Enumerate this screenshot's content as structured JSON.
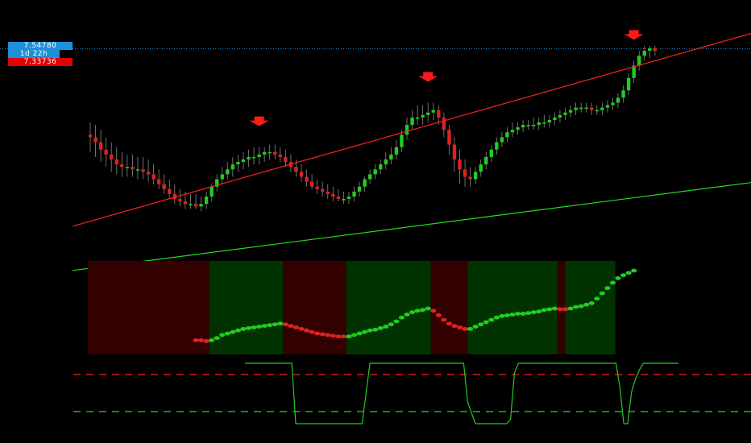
{
  "colors": {
    "background": "#000000",
    "bull": "#22cc22",
    "bear": "#dd2222",
    "wick": "#888888",
    "upper_channel": "#ff2020",
    "lower_channel": "#22dd22",
    "bull_zone": "#003300",
    "bear_zone": "#330000",
    "price_tag": "#1e90d8",
    "low_tag": "#e00000",
    "arrow": "#ff1a1a"
  },
  "price_labels": {
    "last": "7.54780",
    "countdown": "1d 22h",
    "low": "7.33736"
  },
  "chart_data": [
    {
      "type": "candlestick",
      "ohlc": [
        [
          7.2,
          7.25,
          7.13,
          7.19
        ],
        [
          7.19,
          7.24,
          7.11,
          7.17
        ],
        [
          7.17,
          7.22,
          7.09,
          7.14
        ],
        [
          7.14,
          7.19,
          7.07,
          7.12
        ],
        [
          7.12,
          7.17,
          7.05,
          7.1
        ],
        [
          7.1,
          7.15,
          7.04,
          7.08
        ],
        [
          7.08,
          7.13,
          7.03,
          7.07
        ],
        [
          7.07,
          7.12,
          7.03,
          7.07
        ],
        [
          7.07,
          7.12,
          7.03,
          7.06
        ],
        [
          7.06,
          7.11,
          7.02,
          7.06
        ],
        [
          7.06,
          7.11,
          7.02,
          7.05
        ],
        [
          7.05,
          7.1,
          7.01,
          7.04
        ],
        [
          7.04,
          7.08,
          7.0,
          7.02
        ],
        [
          7.02,
          7.06,
          6.98,
          7.0
        ],
        [
          7.0,
          7.04,
          6.96,
          6.98
        ],
        [
          6.98,
          7.02,
          6.94,
          6.96
        ],
        [
          6.96,
          7.0,
          6.92,
          6.94
        ],
        [
          6.94,
          6.98,
          6.91,
          6.93
        ],
        [
          6.93,
          6.97,
          6.9,
          6.92
        ],
        [
          6.92,
          6.96,
          6.9,
          6.92
        ],
        [
          6.92,
          6.96,
          6.9,
          6.91
        ],
        [
          6.91,
          6.95,
          6.89,
          6.92
        ],
        [
          6.92,
          6.97,
          6.9,
          6.95
        ],
        [
          6.95,
          7.0,
          6.93,
          6.99
        ],
        [
          6.99,
          7.04,
          6.97,
          7.02
        ],
        [
          7.02,
          7.07,
          7.0,
          7.04
        ],
        [
          7.04,
          7.09,
          7.02,
          7.06
        ],
        [
          7.06,
          7.11,
          7.03,
          7.08
        ],
        [
          7.08,
          7.12,
          7.05,
          7.09
        ],
        [
          7.09,
          7.13,
          7.06,
          7.1
        ],
        [
          7.1,
          7.14,
          7.07,
          7.11
        ],
        [
          7.11,
          7.15,
          7.08,
          7.11
        ],
        [
          7.11,
          7.15,
          7.08,
          7.12
        ],
        [
          7.12,
          7.15,
          7.09,
          7.13
        ],
        [
          7.13,
          7.16,
          7.1,
          7.13
        ],
        [
          7.13,
          7.16,
          7.1,
          7.12
        ],
        [
          7.12,
          7.15,
          7.09,
          7.11
        ],
        [
          7.11,
          7.14,
          7.07,
          7.09
        ],
        [
          7.09,
          7.12,
          7.05,
          7.07
        ],
        [
          7.07,
          7.1,
          7.03,
          7.05
        ],
        [
          7.05,
          7.08,
          7.01,
          7.03
        ],
        [
          7.03,
          7.06,
          6.99,
          7.01
        ],
        [
          7.01,
          7.04,
          6.98,
          6.99
        ],
        [
          6.99,
          7.02,
          6.96,
          6.98
        ],
        [
          6.98,
          7.01,
          6.95,
          6.97
        ],
        [
          6.97,
          7.0,
          6.94,
          6.96
        ],
        [
          6.96,
          6.99,
          6.93,
          6.95
        ],
        [
          6.95,
          6.98,
          6.93,
          6.94
        ],
        [
          6.94,
          6.97,
          6.92,
          6.94
        ],
        [
          6.94,
          6.97,
          6.92,
          6.95
        ],
        [
          6.95,
          6.99,
          6.93,
          6.97
        ],
        [
          6.97,
          7.01,
          6.95,
          6.99
        ],
        [
          6.99,
          7.03,
          6.97,
          7.02
        ],
        [
          7.02,
          7.06,
          7.0,
          7.04
        ],
        [
          7.04,
          7.08,
          7.02,
          7.06
        ],
        [
          7.06,
          7.1,
          7.04,
          7.08
        ],
        [
          7.08,
          7.13,
          7.06,
          7.1
        ],
        [
          7.1,
          7.15,
          7.08,
          7.12
        ],
        [
          7.12,
          7.18,
          7.1,
          7.15
        ],
        [
          7.15,
          7.22,
          7.13,
          7.2
        ],
        [
          7.2,
          7.27,
          7.18,
          7.24
        ],
        [
          7.24,
          7.3,
          7.22,
          7.27
        ],
        [
          7.27,
          7.32,
          7.24,
          7.27
        ],
        [
          7.27,
          7.32,
          7.24,
          7.28
        ],
        [
          7.28,
          7.33,
          7.25,
          7.29
        ],
        [
          7.29,
          7.33,
          7.26,
          7.3
        ],
        [
          7.3,
          7.32,
          7.24,
          7.27
        ],
        [
          7.27,
          7.29,
          7.19,
          7.22
        ],
        [
          7.22,
          7.24,
          7.12,
          7.16
        ],
        [
          7.16,
          7.19,
          7.05,
          7.1
        ],
        [
          7.1,
          7.14,
          7.0,
          7.06
        ],
        [
          7.06,
          7.1,
          6.99,
          7.03
        ],
        [
          7.03,
          7.07,
          6.99,
          7.02
        ],
        [
          7.02,
          7.07,
          7.0,
          7.05
        ],
        [
          7.05,
          7.1,
          7.03,
          7.08
        ],
        [
          7.08,
          7.13,
          7.06,
          7.11
        ],
        [
          7.11,
          7.16,
          7.09,
          7.14
        ],
        [
          7.14,
          7.19,
          7.12,
          7.17
        ],
        [
          7.17,
          7.21,
          7.15,
          7.19
        ],
        [
          7.19,
          7.23,
          7.17,
          7.21
        ],
        [
          7.21,
          7.25,
          7.19,
          7.22
        ],
        [
          7.22,
          7.25,
          7.2,
          7.23
        ],
        [
          7.23,
          7.26,
          7.21,
          7.24
        ],
        [
          7.24,
          7.26,
          7.22,
          7.24
        ],
        [
          7.24,
          7.27,
          7.22,
          7.24
        ],
        [
          7.24,
          7.27,
          7.22,
          7.25
        ],
        [
          7.25,
          7.28,
          7.23,
          7.25
        ],
        [
          7.25,
          7.28,
          7.23,
          7.26
        ],
        [
          7.26,
          7.29,
          7.24,
          7.27
        ],
        [
          7.27,
          7.3,
          7.25,
          7.28
        ],
        [
          7.28,
          7.31,
          7.26,
          7.29
        ],
        [
          7.29,
          7.32,
          7.27,
          7.3
        ],
        [
          7.3,
          7.33,
          7.28,
          7.31
        ],
        [
          7.31,
          7.33,
          7.29,
          7.31
        ],
        [
          7.31,
          7.33,
          7.29,
          7.31
        ],
        [
          7.31,
          7.33,
          7.28,
          7.3
        ],
        [
          7.3,
          7.32,
          7.28,
          7.3
        ],
        [
          7.3,
          7.33,
          7.28,
          7.31
        ],
        [
          7.31,
          7.34,
          7.29,
          7.32
        ],
        [
          7.32,
          7.35,
          7.3,
          7.33
        ],
        [
          7.33,
          7.37,
          7.31,
          7.35
        ],
        [
          7.35,
          7.4,
          7.33,
          7.38
        ],
        [
          7.38,
          7.45,
          7.36,
          7.43
        ],
        [
          7.43,
          7.5,
          7.41,
          7.48
        ],
        [
          7.48,
          7.54,
          7.46,
          7.52
        ],
        [
          7.52,
          7.56,
          7.5,
          7.54
        ],
        [
          7.54,
          7.56,
          7.51,
          7.55
        ],
        [
          7.55,
          7.56,
          7.52,
          7.54
        ]
      ],
      "channel_upper": [
        [
          0,
          6.85
        ],
        [
          112,
          7.53
        ]
      ],
      "channel_lower": [
        [
          0,
          6.66
        ],
        [
          112,
          6.97
        ]
      ],
      "sell_arrows_at": [
        32,
        64,
        103
      ],
      "price_levels": {
        "last": 7.5478,
        "low": 7.33736
      }
    },
    {
      "type": "scatter",
      "zones": [
        {
          "from": 0,
          "to": 23,
          "state": "bear"
        },
        {
          "from": 23,
          "to": 37,
          "state": "bull"
        },
        {
          "from": 37,
          "to": 49,
          "state": "bear"
        },
        {
          "from": 49,
          "to": 65,
          "state": "bull"
        },
        {
          "from": 65,
          "to": 72,
          "state": "bear"
        },
        {
          "from": 72,
          "to": 89,
          "state": "bull"
        },
        {
          "from": 89,
          "to": 90.5,
          "state": "bear"
        },
        {
          "from": 90.5,
          "to": 100,
          "state": "bull"
        }
      ],
      "dots": [
        {
          "i": 20,
          "v": 0.08,
          "s": "bear"
        },
        {
          "i": 21,
          "v": 0.08,
          "s": "bear"
        },
        {
          "i": 22,
          "v": 0.07,
          "s": "bear"
        },
        {
          "i": 23,
          "v": 0.08,
          "s": "bull"
        },
        {
          "i": 24,
          "v": 0.11,
          "s": "bull"
        },
        {
          "i": 25,
          "v": 0.15,
          "s": "bull"
        },
        {
          "i": 26,
          "v": 0.17,
          "s": "bull"
        },
        {
          "i": 27,
          "v": 0.19,
          "s": "bull"
        },
        {
          "i": 28,
          "v": 0.21,
          "s": "bull"
        },
        {
          "i": 29,
          "v": 0.23,
          "s": "bull"
        },
        {
          "i": 30,
          "v": 0.24,
          "s": "bull"
        },
        {
          "i": 31,
          "v": 0.25,
          "s": "bull"
        },
        {
          "i": 32,
          "v": 0.26,
          "s": "bull"
        },
        {
          "i": 33,
          "v": 0.27,
          "s": "bull"
        },
        {
          "i": 34,
          "v": 0.28,
          "s": "bull"
        },
        {
          "i": 35,
          "v": 0.29,
          "s": "bull"
        },
        {
          "i": 36,
          "v": 0.3,
          "s": "bull"
        },
        {
          "i": 37,
          "v": 0.29,
          "s": "bear"
        },
        {
          "i": 38,
          "v": 0.27,
          "s": "bear"
        },
        {
          "i": 39,
          "v": 0.25,
          "s": "bear"
        },
        {
          "i": 40,
          "v": 0.23,
          "s": "bear"
        },
        {
          "i": 41,
          "v": 0.21,
          "s": "bear"
        },
        {
          "i": 42,
          "v": 0.19,
          "s": "bear"
        },
        {
          "i": 43,
          "v": 0.17,
          "s": "bear"
        },
        {
          "i": 44,
          "v": 0.16,
          "s": "bear"
        },
        {
          "i": 45,
          "v": 0.15,
          "s": "bear"
        },
        {
          "i": 46,
          "v": 0.14,
          "s": "bear"
        },
        {
          "i": 47,
          "v": 0.13,
          "s": "bear"
        },
        {
          "i": 48,
          "v": 0.13,
          "s": "bear"
        },
        {
          "i": 49,
          "v": 0.13,
          "s": "bull"
        },
        {
          "i": 50,
          "v": 0.15,
          "s": "bull"
        },
        {
          "i": 51,
          "v": 0.17,
          "s": "bull"
        },
        {
          "i": 52,
          "v": 0.19,
          "s": "bull"
        },
        {
          "i": 53,
          "v": 0.21,
          "s": "bull"
        },
        {
          "i": 54,
          "v": 0.22,
          "s": "bull"
        },
        {
          "i": 55,
          "v": 0.24,
          "s": "bull"
        },
        {
          "i": 56,
          "v": 0.26,
          "s": "bull"
        },
        {
          "i": 57,
          "v": 0.29,
          "s": "bull"
        },
        {
          "i": 58,
          "v": 0.33,
          "s": "bull"
        },
        {
          "i": 59,
          "v": 0.38,
          "s": "bull"
        },
        {
          "i": 60,
          "v": 0.42,
          "s": "bull"
        },
        {
          "i": 61,
          "v": 0.45,
          "s": "bull"
        },
        {
          "i": 62,
          "v": 0.47,
          "s": "bull"
        },
        {
          "i": 63,
          "v": 0.48,
          "s": "bull"
        },
        {
          "i": 64,
          "v": 0.5,
          "s": "bull"
        },
        {
          "i": 65,
          "v": 0.47,
          "s": "bear"
        },
        {
          "i": 66,
          "v": 0.41,
          "s": "bear"
        },
        {
          "i": 67,
          "v": 0.35,
          "s": "bear"
        },
        {
          "i": 68,
          "v": 0.3,
          "s": "bear"
        },
        {
          "i": 69,
          "v": 0.27,
          "s": "bear"
        },
        {
          "i": 70,
          "v": 0.25,
          "s": "bear"
        },
        {
          "i": 71,
          "v": 0.23,
          "s": "bear"
        },
        {
          "i": 72,
          "v": 0.23,
          "s": "bull"
        },
        {
          "i": 73,
          "v": 0.26,
          "s": "bull"
        },
        {
          "i": 74,
          "v": 0.29,
          "s": "bull"
        },
        {
          "i": 75,
          "v": 0.32,
          "s": "bull"
        },
        {
          "i": 76,
          "v": 0.35,
          "s": "bull"
        },
        {
          "i": 77,
          "v": 0.38,
          "s": "bull"
        },
        {
          "i": 78,
          "v": 0.4,
          "s": "bull"
        },
        {
          "i": 79,
          "v": 0.41,
          "s": "bull"
        },
        {
          "i": 80,
          "v": 0.42,
          "s": "bull"
        },
        {
          "i": 81,
          "v": 0.43,
          "s": "bull"
        },
        {
          "i": 82,
          "v": 0.43,
          "s": "bull"
        },
        {
          "i": 83,
          "v": 0.44,
          "s": "bull"
        },
        {
          "i": 84,
          "v": 0.45,
          "s": "bull"
        },
        {
          "i": 85,
          "v": 0.46,
          "s": "bull"
        },
        {
          "i": 86,
          "v": 0.48,
          "s": "bull"
        },
        {
          "i": 87,
          "v": 0.49,
          "s": "bull"
        },
        {
          "i": 88,
          "v": 0.5,
          "s": "bull"
        },
        {
          "i": 89,
          "v": 0.49,
          "s": "bear"
        },
        {
          "i": 90,
          "v": 0.49,
          "s": "bear"
        },
        {
          "i": 91,
          "v": 0.5,
          "s": "bull"
        },
        {
          "i": 92,
          "v": 0.52,
          "s": "bull"
        },
        {
          "i": 93,
          "v": 0.53,
          "s": "bull"
        },
        {
          "i": 94,
          "v": 0.55,
          "s": "bull"
        },
        {
          "i": 95,
          "v": 0.57,
          "s": "bull"
        },
        {
          "i": 96,
          "v": 0.63,
          "s": "bull"
        },
        {
          "i": 97,
          "v": 0.7,
          "s": "bull"
        },
        {
          "i": 98,
          "v": 0.77,
          "s": "bull"
        },
        {
          "i": 99,
          "v": 0.84,
          "s": "bull"
        },
        {
          "i": 100,
          "v": 0.9,
          "s": "bull"
        },
        {
          "i": 101,
          "v": 0.94,
          "s": "bull"
        },
        {
          "i": 102,
          "v": 0.97,
          "s": "bull"
        },
        {
          "i": 103,
          "v": 1.0,
          "s": "bull"
        }
      ]
    },
    {
      "type": "line",
      "upper_level": 0.8,
      "lower_level": 0.2,
      "series": [
        {
          "x": 0,
          "y": 1.0
        },
        {
          "x": 12,
          "y": 1.0
        },
        {
          "x": 13,
          "y": 0.0
        },
        {
          "x": 30,
          "y": 0.0
        },
        {
          "x": 32,
          "y": 1.0
        },
        {
          "x": 56,
          "y": 1.0
        },
        {
          "x": 57,
          "y": 0.36
        },
        {
          "x": 59,
          "y": 0.0
        },
        {
          "x": 67,
          "y": 0.0
        },
        {
          "x": 68,
          "y": 0.07
        },
        {
          "x": 69,
          "y": 0.84
        },
        {
          "x": 70,
          "y": 1.0
        },
        {
          "x": 95,
          "y": 1.0
        },
        {
          "x": 96,
          "y": 0.6
        },
        {
          "x": 97,
          "y": 0.0
        },
        {
          "x": 98,
          "y": 0.0
        },
        {
          "x": 99,
          "y": 0.53
        },
        {
          "x": 100,
          "y": 0.74
        },
        {
          "x": 101,
          "y": 0.89
        },
        {
          "x": 102,
          "y": 1.0
        },
        {
          "x": 111,
          "y": 1.0
        }
      ]
    }
  ]
}
